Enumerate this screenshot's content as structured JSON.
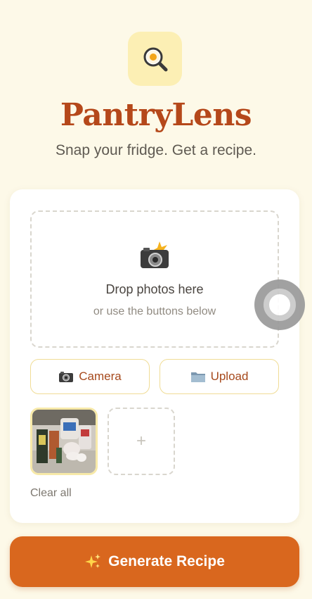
{
  "app": {
    "title": "PantryLens",
    "tagline": "Snap your fridge. Get a recipe.",
    "logo_icon": "magnifier-egg-icon"
  },
  "dropzone": {
    "icon": "camera-flash-icon",
    "title": "Drop photos here",
    "subtitle": "or use the buttons below"
  },
  "buttons": {
    "camera": {
      "icon": "camera-icon",
      "label": "Camera"
    },
    "upload": {
      "icon": "folder-icon",
      "label": "Upload"
    }
  },
  "photos": {
    "thumbnails": [
      {
        "name": "pantry-photo-1"
      }
    ],
    "add_label": "+",
    "clear_label": "Clear all"
  },
  "generate": {
    "icon": "sparkles-icon",
    "label": "Generate Recipe"
  },
  "colors": {
    "background": "#fdf9e8",
    "brand": "#b5481a",
    "accent": "#d9671e",
    "logo_bg": "#fcefb4"
  }
}
